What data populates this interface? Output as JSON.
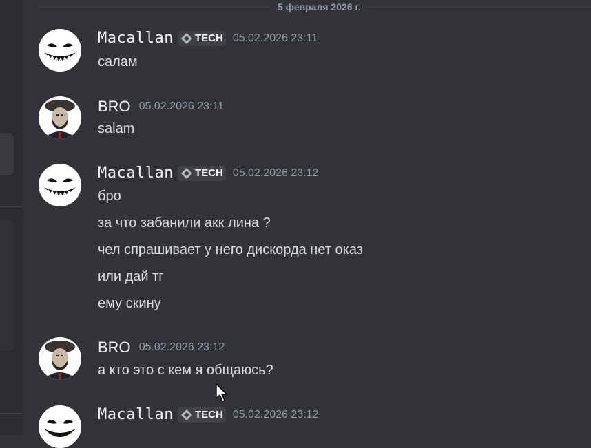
{
  "date_divider": "5 февраля 2026 г.",
  "colors": {
    "background": "#323339",
    "text": "#dbdee1",
    "muted": "#949ba4",
    "tag_bg": "#3f4147"
  },
  "messages": [
    {
      "author": "Macallan",
      "tag": "TECH",
      "timestamp": "05.02.2026 23:11",
      "lines": [
        "салам"
      ]
    },
    {
      "author": "BRO",
      "tag": "",
      "timestamp": "05.02.2026 23:11",
      "lines": [
        "salam"
      ]
    },
    {
      "author": "Macallan",
      "tag": "TECH",
      "timestamp": "05.02.2026 23:12",
      "lines": [
        "бро",
        "за что забанили акк лина ?",
        "чел спрашивает у него дискорда нет оказ",
        "или дай тг",
        "ему скину"
      ]
    },
    {
      "author": "BRO",
      "tag": "",
      "timestamp": "05.02.2026 23:12",
      "lines": [
        "а кто это с кем я общаюсь?"
      ]
    },
    {
      "author": "Macallan",
      "tag": "TECH",
      "timestamp": "05.02.2026 23:12",
      "lines": []
    }
  ]
}
